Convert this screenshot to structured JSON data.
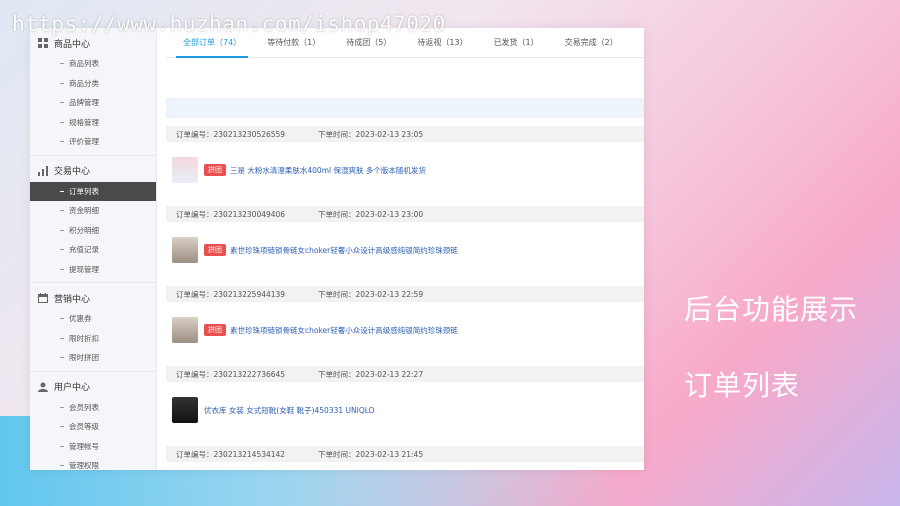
{
  "watermark": "https://www.huzhan.com/ishop47020",
  "sidebar": {
    "groups": [
      {
        "title": "商品中心",
        "items": [
          {
            "label": "商品列表"
          },
          {
            "label": "商品分类"
          },
          {
            "label": "品牌管理"
          },
          {
            "label": "规格管理"
          },
          {
            "label": "评价管理"
          }
        ]
      },
      {
        "title": "交易中心",
        "items": [
          {
            "label": "订单列表"
          },
          {
            "label": "资金明细"
          },
          {
            "label": "积分明细"
          },
          {
            "label": "充值记录"
          },
          {
            "label": "提现管理"
          }
        ]
      },
      {
        "title": "营销中心",
        "items": [
          {
            "label": "优惠券"
          },
          {
            "label": "限时折扣"
          },
          {
            "label": "限时拼团"
          }
        ]
      },
      {
        "title": "用户中心",
        "items": [
          {
            "label": "会员列表"
          },
          {
            "label": "会员等级"
          },
          {
            "label": "管理帐号"
          },
          {
            "label": "管理权限"
          }
        ]
      }
    ],
    "active_item": "订单列表"
  },
  "tabs": [
    {
      "label": "全部订单（74）"
    },
    {
      "label": "等待付款（1）"
    },
    {
      "label": "待成团（5）"
    },
    {
      "label": "待返视（13）"
    },
    {
      "label": "已发货（1）"
    },
    {
      "label": "交易完成（2）"
    }
  ],
  "order_labels": {
    "number": "订单编号：",
    "time": "下单时间："
  },
  "orders": [
    {
      "number": "230213230526559",
      "time": "2023-02-13 23:05",
      "tag": "拼团",
      "product": "三是 大粉水清澄柔肤水400ml 保湿爽肤 多个版本随机发货"
    },
    {
      "number": "230213230049406",
      "time": "2023-02-13 23:00",
      "tag": "拼团",
      "product": "素世珍珠项链锁骨链女choker轻奢小众设计高级感纯银简约珍珠颈链"
    },
    {
      "number": "230213225944139",
      "time": "2023-02-13 22:59",
      "tag": "拼团",
      "product": "素世珍珠项链锁骨链女choker轻奢小众设计高级感纯银简约珍珠颈链"
    },
    {
      "number": "230213222736645",
      "time": "2023-02-13 22:27",
      "tag": "",
      "product": "优衣库 女装 女式短靴(女鞋 靴子)450331 UNIQLO"
    },
    {
      "number": "230213214534142",
      "time": "2023-02-13 21:45",
      "tag": "",
      "product": ""
    }
  ],
  "captions": {
    "line1": "后台功能展示",
    "line2": "订单列表"
  },
  "colors": {
    "accent": "#1e9be0",
    "tag": "#e95050",
    "sidebar_active": "#4a4a4a",
    "link": "#2a5db0"
  }
}
